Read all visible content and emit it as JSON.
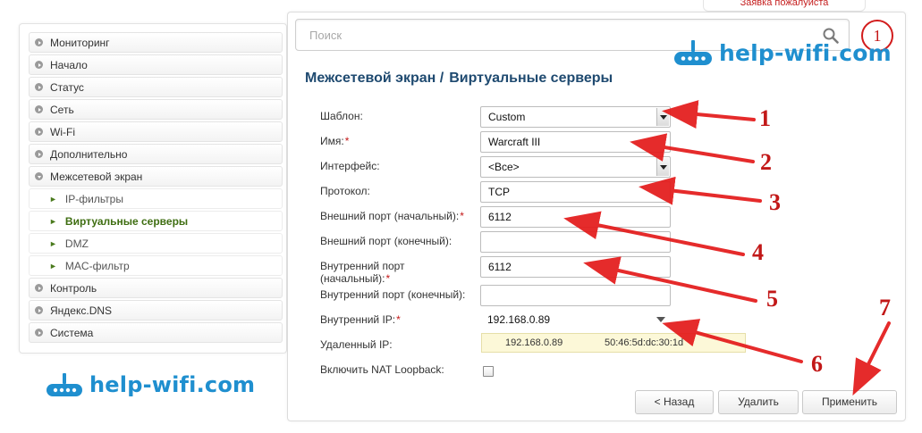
{
  "top_tab": {
    "text": "Заявка пожалуйста"
  },
  "search": {
    "placeholder": "Поиск"
  },
  "marker_circle": "1",
  "logo": {
    "text": "help-wifi.com"
  },
  "sidebar": {
    "items": [
      {
        "label": "Мониторинг"
      },
      {
        "label": "Начало"
      },
      {
        "label": "Статус"
      },
      {
        "label": "Сеть"
      },
      {
        "label": "Wi-Fi"
      },
      {
        "label": "Дополнительно"
      },
      {
        "label": "Межсетевой экран"
      },
      {
        "label": "IP-фильтры"
      },
      {
        "label": "Виртуальные серверы"
      },
      {
        "label": "DMZ"
      },
      {
        "label": "MAC-фильтр"
      },
      {
        "label": "Контроль"
      },
      {
        "label": "Яндекс.DNS"
      },
      {
        "label": "Система"
      }
    ]
  },
  "page_title": {
    "section": "Межсетевой экран /",
    "page": "Виртуальные серверы"
  },
  "form": {
    "template": {
      "label": "Шаблон:",
      "value": "Custom"
    },
    "name": {
      "label": "Имя:",
      "value": "Warcraft III"
    },
    "interface": {
      "label": "Интерфейс:",
      "value": "<Все>"
    },
    "protocol": {
      "label": "Протокол:",
      "value": "TCP"
    },
    "ext_port_start": {
      "label": "Внешний порт (начальный):",
      "value": "6112"
    },
    "ext_port_end": {
      "label": "Внешний порт (конечный):",
      "value": ""
    },
    "int_port_start": {
      "label_line1": "Внутренний порт",
      "label_line2": "(начальный):",
      "value": "6112"
    },
    "int_port_end": {
      "label": "Внутренний порт (конечный):",
      "value": ""
    },
    "internal_ip": {
      "label": "Внутренний IP:",
      "value": "192.168.0.89"
    },
    "remote_ip": {
      "label": "Удаленный IP:"
    },
    "nat_loopback": {
      "label": "Включить NAT Loopback:",
      "checked": false
    },
    "required_mark": "*"
  },
  "ip_dropdown": {
    "ip": "192.168.0.89",
    "mac": "50:46:5d:dc:30:1d"
  },
  "buttons": {
    "back": "< Назад",
    "delete": "Удалить",
    "apply": "Применить"
  },
  "annotations": [
    "1",
    "2",
    "3",
    "4",
    "5",
    "6",
    "7"
  ],
  "colors": {
    "title": "#1f4a70",
    "arrow": "#e41b1b",
    "logo": "#1f8fcf",
    "active_nav": "#3f6e12"
  }
}
